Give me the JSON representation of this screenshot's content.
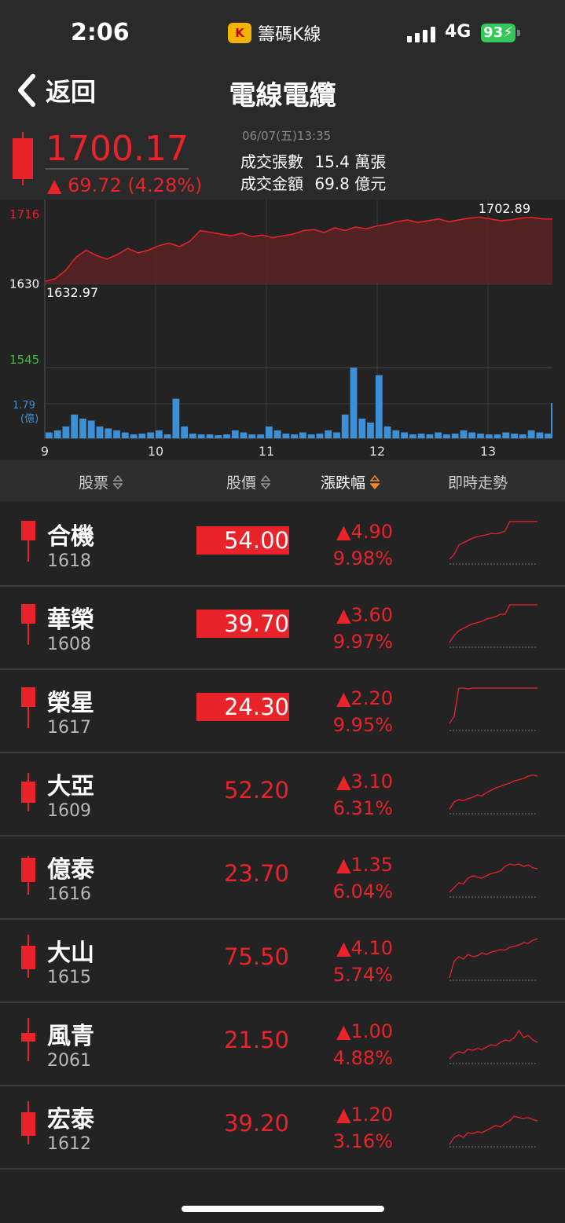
{
  "status_bar": {
    "time": "2:06",
    "app_name": "籌碼K線",
    "app_logo_text": "K",
    "network": "4G",
    "battery": "93"
  },
  "header": {
    "back_label": "返回",
    "title": "電線電纜"
  },
  "summary": {
    "price": "1700.17",
    "change": "▲ 69.72 (4.28%)",
    "datetime": "06/07(五)13:35",
    "volume_label": "成交張數",
    "volume_value": "15.4 萬張",
    "amount_label": "成交金額",
    "amount_value": "69.8 億元"
  },
  "chart_data": {
    "type": "area",
    "y_ticks": [
      "1716",
      "1630",
      "1545"
    ],
    "y_range": [
      1545,
      1716
    ],
    "reference": 1630,
    "x_ticks": [
      "9",
      "10",
      "11",
      "12",
      "13"
    ],
    "open_label": "1632.97",
    "last_label": "1702.89",
    "volume_max_label": "1.79",
    "volume_unit": "(億)",
    "price_line": [
      1632.97,
      1636,
      1645,
      1660,
      1668,
      1662,
      1658,
      1663,
      1670,
      1665,
      1668,
      1673,
      1676,
      1672,
      1678,
      1690,
      1688,
      1686,
      1684,
      1687,
      1683,
      1685,
      1682,
      1684,
      1686,
      1690,
      1691,
      1688,
      1693,
      1690,
      1694,
      1692,
      1695,
      1697,
      1700,
      1702,
      1699,
      1701,
      1703,
      1700,
      1702,
      1704,
      1705,
      1703,
      1701,
      1702,
      1704,
      1705,
      1703,
      1702.89
    ],
    "volume_bars": [
      0.15,
      0.2,
      0.3,
      0.6,
      0.5,
      0.45,
      0.3,
      0.25,
      0.2,
      0.15,
      0.1,
      0.12,
      0.15,
      0.2,
      0.1,
      1.0,
      0.3,
      0.12,
      0.1,
      0.1,
      0.08,
      0.1,
      0.2,
      0.15,
      0.1,
      0.1,
      0.3,
      0.2,
      0.12,
      0.1,
      0.15,
      0.1,
      0.12,
      0.2,
      0.15,
      0.6,
      1.79,
      0.5,
      0.4,
      1.6,
      0.3,
      0.2,
      0.15,
      0.1,
      0.12,
      0.1,
      0.15,
      0.1,
      0.12,
      0.2,
      0.15,
      0.12,
      0.1,
      0.1,
      0.15,
      0.12,
      0.1,
      0.2,
      0.15,
      0.12
    ]
  },
  "table": {
    "headers": [
      "股票",
      "股價",
      "漲跌幅",
      "即時走勢"
    ],
    "rows": [
      {
        "name": "合機",
        "code": "1618",
        "price": "54.00",
        "limit": true,
        "chg": "▲4.90",
        "pct": "9.98%",
        "candle": [
          0.5,
          0.95,
          0.1
        ],
        "spark": [
          0.9,
          0.8,
          0.6,
          0.55,
          0.5,
          0.45,
          0.42,
          0.4,
          0.38,
          0.35,
          0.36,
          0.34,
          0.3,
          0.1,
          0.1,
          0.1,
          0.1,
          0.1,
          0.1,
          0.1
        ]
      },
      {
        "name": "華榮",
        "code": "1608",
        "price": "39.70",
        "limit": true,
        "chg": "▲3.60",
        "pct": "9.97%",
        "candle": [
          0.5,
          0.95,
          0.1
        ],
        "spark": [
          0.9,
          0.75,
          0.65,
          0.6,
          0.55,
          0.5,
          0.48,
          0.45,
          0.4,
          0.38,
          0.35,
          0.3,
          0.3,
          0.1,
          0.1,
          0.1,
          0.1,
          0.1,
          0.1,
          0.1
        ]
      },
      {
        "name": "榮星",
        "code": "1617",
        "price": "24.30",
        "limit": true,
        "chg": "▲2.20",
        "pct": "9.95%",
        "candle": [
          0.5,
          0.95,
          0.1
        ],
        "spark": [
          0.85,
          0.7,
          0.1,
          0.1,
          0.12,
          0.1,
          0.1,
          0.1,
          0.1,
          0.1,
          0.1,
          0.1,
          0.1,
          0.1,
          0.1,
          0.1,
          0.1,
          0.1,
          0.1,
          0.1
        ]
      },
      {
        "name": "大亞",
        "code": "1609",
        "price": "52.20",
        "limit": false,
        "chg": "▲3.10",
        "pct": "6.31%",
        "candle": [
          0.2,
          0.7,
          0.1
        ],
        "spark": [
          0.9,
          0.75,
          0.7,
          0.72,
          0.68,
          0.65,
          0.6,
          0.62,
          0.55,
          0.5,
          0.45,
          0.42,
          0.38,
          0.35,
          0.3,
          0.28,
          0.25,
          0.2,
          0.18,
          0.2
        ]
      },
      {
        "name": "億泰",
        "code": "1616",
        "price": "23.70",
        "limit": false,
        "chg": "▲1.35",
        "pct": "6.04%",
        "candle": [
          0.3,
          0.85,
          0.1
        ],
        "spark": [
          0.9,
          0.8,
          0.7,
          0.72,
          0.6,
          0.55,
          0.58,
          0.6,
          0.55,
          0.5,
          0.48,
          0.45,
          0.35,
          0.3,
          0.32,
          0.3,
          0.35,
          0.32,
          0.38,
          0.4
        ]
      },
      {
        "name": "大山",
        "code": "1615",
        "price": "75.50",
        "limit": false,
        "chg": "▲4.10",
        "pct": "5.74%",
        "candle": [
          0.2,
          0.75,
          0.0
        ],
        "spark": [
          0.95,
          0.6,
          0.5,
          0.55,
          0.45,
          0.5,
          0.48,
          0.42,
          0.45,
          0.4,
          0.38,
          0.35,
          0.36,
          0.3,
          0.28,
          0.25,
          0.2,
          0.22,
          0.15,
          0.12
        ]
      },
      {
        "name": "風青",
        "code": "2061",
        "price": "21.50",
        "limit": false,
        "chg": "▲1.00",
        "pct": "4.88%",
        "candle": [
          0.45,
          0.65,
          0.0
        ],
        "spark": [
          0.9,
          0.8,
          0.75,
          0.78,
          0.7,
          0.72,
          0.68,
          0.7,
          0.65,
          0.6,
          0.62,
          0.55,
          0.5,
          0.52,
          0.45,
          0.3,
          0.45,
          0.4,
          0.5,
          0.55
        ]
      },
      {
        "name": "宏泰",
        "code": "1612",
        "price": "39.20",
        "limit": false,
        "chg": "▲1.20",
        "pct": "3.16%",
        "candle": [
          0.2,
          0.75,
          0.0
        ],
        "spark": [
          0.95,
          0.8,
          0.75,
          0.8,
          0.7,
          0.72,
          0.68,
          0.7,
          0.65,
          0.6,
          0.55,
          0.58,
          0.5,
          0.45,
          0.35,
          0.38,
          0.4,
          0.38,
          0.42,
          0.45
        ]
      }
    ]
  },
  "colors": {
    "up": "#e8232a",
    "down": "#3bbd3b",
    "volume": "#3d8fd6",
    "area": "#5a2222"
  }
}
